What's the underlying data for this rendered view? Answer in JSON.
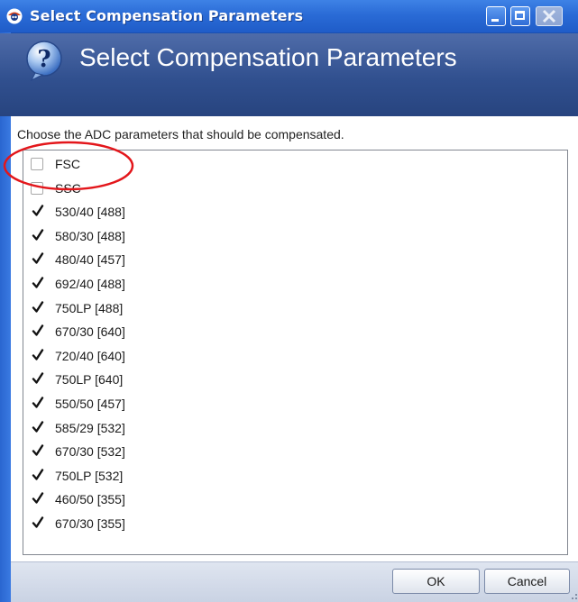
{
  "window": {
    "title": "Select Compensation Parameters",
    "header_title": "Select Compensation Parameters"
  },
  "instruction": "Choose the ADC parameters that should be compensated.",
  "parameters": [
    {
      "label": "FSC",
      "checked": false
    },
    {
      "label": "SSC",
      "checked": false
    },
    {
      "label": "530/40 [488]",
      "checked": true
    },
    {
      "label": "580/30 [488]",
      "checked": true
    },
    {
      "label": "480/40 [457]",
      "checked": true
    },
    {
      "label": "692/40 [488]",
      "checked": true
    },
    {
      "label": "750LP [488]",
      "checked": true
    },
    {
      "label": "670/30 [640]",
      "checked": true
    },
    {
      "label": "720/40 [640]",
      "checked": true
    },
    {
      "label": "750LP [640]",
      "checked": true
    },
    {
      "label": "550/50 [457]",
      "checked": true
    },
    {
      "label": "585/29 [532]",
      "checked": true
    },
    {
      "label": "670/30 [532]",
      "checked": true
    },
    {
      "label": "750LP [532]",
      "checked": true
    },
    {
      "label": "460/50 [355]",
      "checked": true
    },
    {
      "label": "670/30 [355]",
      "checked": true
    }
  ],
  "buttons": {
    "ok": "OK",
    "cancel": "Cancel"
  },
  "icons": {
    "app": "app-icon",
    "help": "help-question-icon",
    "checkbox_checked": "checkmark-icon",
    "annotation": "red-ellipse-annotation"
  },
  "colors": {
    "titlebar": "#2a6bd6",
    "header": "#31508f",
    "annotation": "#e3161b"
  }
}
